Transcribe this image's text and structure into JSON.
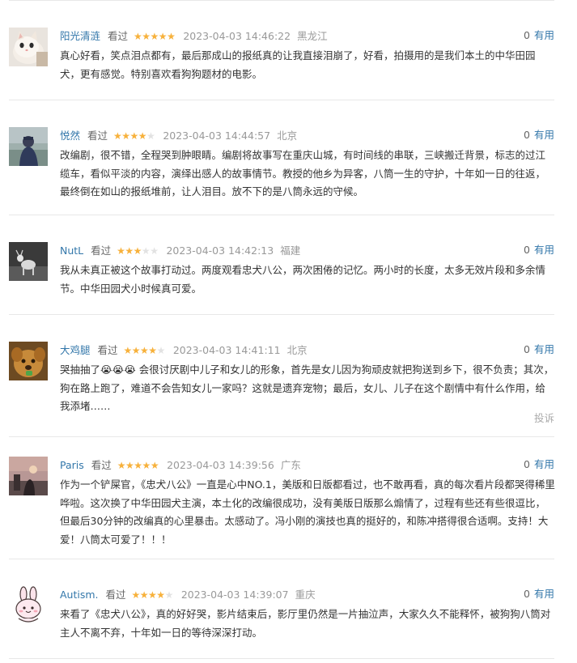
{
  "reviews": [
    {
      "user": "阳光清涟",
      "status": "看过",
      "rating": 5,
      "stars": [
        "★",
        "★",
        "★",
        "★",
        "★"
      ],
      "time": "2023-04-03 14:46:22",
      "location": "黑龙江",
      "useful_count": "0",
      "useful_label": "有用",
      "avatar": "cat-avatar-image",
      "content": "真心好看，笑点泪点都有，最后那成山的报纸真的让我直接泪崩了，好看，拍摄用的是我们本土的中华田园犬，更有感觉。特别喜欢看狗狗题材的电影。"
    },
    {
      "user": "悦然",
      "status": "看过",
      "rating": 4,
      "stars": [
        "★",
        "★",
        "★",
        "★",
        "★"
      ],
      "time": "2023-04-03 14:44:57",
      "location": "北京",
      "useful_count": "0",
      "useful_label": "有用",
      "avatar": "person-by-lake-avatar-image",
      "content": "改编剧，很不错，全程哭到肿眼睛。编剧将故事写在重庆山城，有时间线的串联，三峡搬迁背景，标志的过江缆车，看似平淡的内容，演绎出感人的故事情节。教授的他乡为异客，八筒一生的守护，十年如一日的往返，最终倒在如山的报纸堆前，让人泪目。放不下的是八筒永远的守候。"
    },
    {
      "user": "NutL",
      "status": "看过",
      "rating": 3,
      "stars": [
        "★",
        "★",
        "★",
        "★",
        "★"
      ],
      "time": "2023-04-03 14:42:13",
      "location": "福建",
      "useful_count": "0",
      "useful_label": "有用",
      "avatar": "deer-avatar-image",
      "content": "我从未真正被这个故事打动过。两度观看忠犬八公，两次困倦的记忆。两小时的长度，太多无效片段和多余情节。中华田园犬小时候真可爱。"
    },
    {
      "user": "大鸡腿",
      "status": "看过",
      "rating": 4,
      "stars": [
        "★",
        "★",
        "★",
        "★",
        "★"
      ],
      "time": "2023-04-03 14:41:11",
      "location": "北京",
      "useful_count": "0",
      "useful_label": "有用",
      "avatar": "dog-avatar-image",
      "content": "哭抽抽了😭😭😭 会很讨厌剧中儿子和女儿的形象，首先是女儿因为狗顽皮就把狗送到乡下，很不负责；其次，狗在路上跑了，难道不会告知女儿一家吗？这就是遗弃宠物；最后，女儿、儿子在这个剧情中有什么作用，给我添堵……",
      "complain_label": "投诉"
    },
    {
      "user": "Paris",
      "status": "看过",
      "rating": 5,
      "stars": [
        "★",
        "★",
        "★",
        "★",
        "★"
      ],
      "time": "2023-04-03 14:39:56",
      "location": "广东",
      "useful_count": "0",
      "useful_label": "有用",
      "avatar": "sunset-avatar-image",
      "content": "作为一个铲屎官，《忠犬八公》一直是心中NO.1，美版和日版都看过，也不敢再看，真的每次看片段都哭得稀里哗啦。这次换了中华田园犬主演，本土化的改编很成功，没有美版日版那么煽情了，过程有些还有些很逗比，但最后30分钟的改编真的心里暴击。太感动了。冯小刚的演技也真的挺好的，和陈冲搭得很合适啊。支持！大爱！八筒太可爱了！！！"
    },
    {
      "user": "Autism.",
      "status": "看过",
      "rating": 4,
      "stars": [
        "★",
        "★",
        "★",
        "★",
        "★"
      ],
      "time": "2023-04-03 14:39:07",
      "location": "重庆",
      "useful_count": "0",
      "useful_label": "有用",
      "avatar": "bunny-cartoon-avatar-image",
      "content": "来看了《忠犬八公》，真的好好哭，影片结束后，影厅里仍然是一片抽泣声，大家久久不能释怀，被狗狗八筒对主人不离不弃，十年如一日的等待深深打动。"
    }
  ]
}
